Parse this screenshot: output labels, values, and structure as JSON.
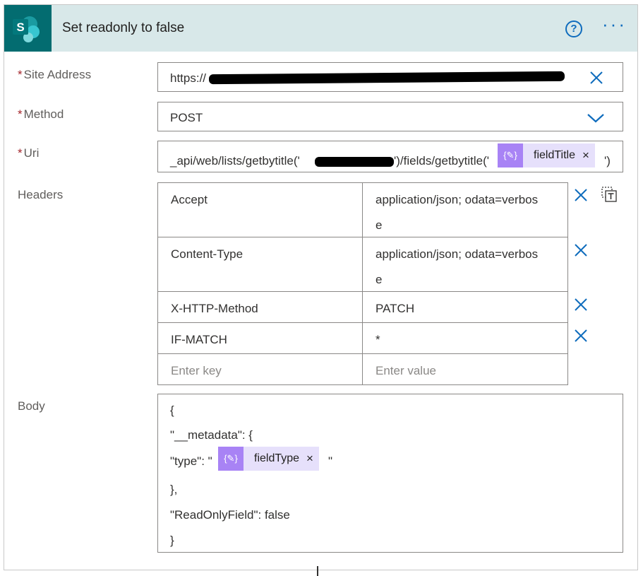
{
  "action": {
    "title": "Set readonly to false",
    "logo_letter": "S",
    "help_icon_glyph": "?",
    "more_glyph": "···"
  },
  "required_marker": "*",
  "fields": {
    "site_address": {
      "label": "Site Address",
      "value": "https://"
    },
    "method": {
      "label": "Method",
      "value": "POST"
    },
    "uri": {
      "label": "Uri",
      "prefix": "_api/web/lists/getbytitle('",
      "middle": "')/fields/getbytitle('",
      "suffix": "')",
      "token": {
        "label": "fieldTitle",
        "close": "×"
      }
    }
  },
  "headers": {
    "label": "Headers",
    "rows": [
      {
        "key": "Accept",
        "value_line1": "application/json; odata=verbos",
        "value_line2": "e"
      },
      {
        "key": "Content-Type",
        "value_line1": "application/json; odata=verbos",
        "value_line2": "e"
      },
      {
        "key": "X-HTTP-Method",
        "value_line1": "PATCH"
      },
      {
        "key": "IF-MATCH",
        "value_line1": "*"
      }
    ],
    "key_placeholder": "Enter key",
    "value_placeholder": "Enter value"
  },
  "body": {
    "label": "Body",
    "line1": "{",
    "line2": "\"__metadata\": {",
    "line3_prefix": "\"type\": \"",
    "line3_suffix": "\"",
    "token": {
      "label": "fieldType",
      "close": "×"
    },
    "line4": "},",
    "line5": "\"ReadOnlyField\": false",
    "line6": "}"
  },
  "colors": {
    "header_bg": "#d8e8e9",
    "logo_bg": "#036c70",
    "accent": "#0f6cbd",
    "token_bg": "#e6e0fb",
    "token_icon_bg": "#a883f5",
    "required": "#a4262c"
  },
  "icons": {
    "logo": "sharepoint-icon",
    "help": "help-circle-icon",
    "more": "ellipsis-icon",
    "clear": "close-icon",
    "dropdown": "chevron-down-icon",
    "remove_row": "close-icon",
    "switch_mode": "text-mode-icon",
    "token": "expression-icon"
  }
}
